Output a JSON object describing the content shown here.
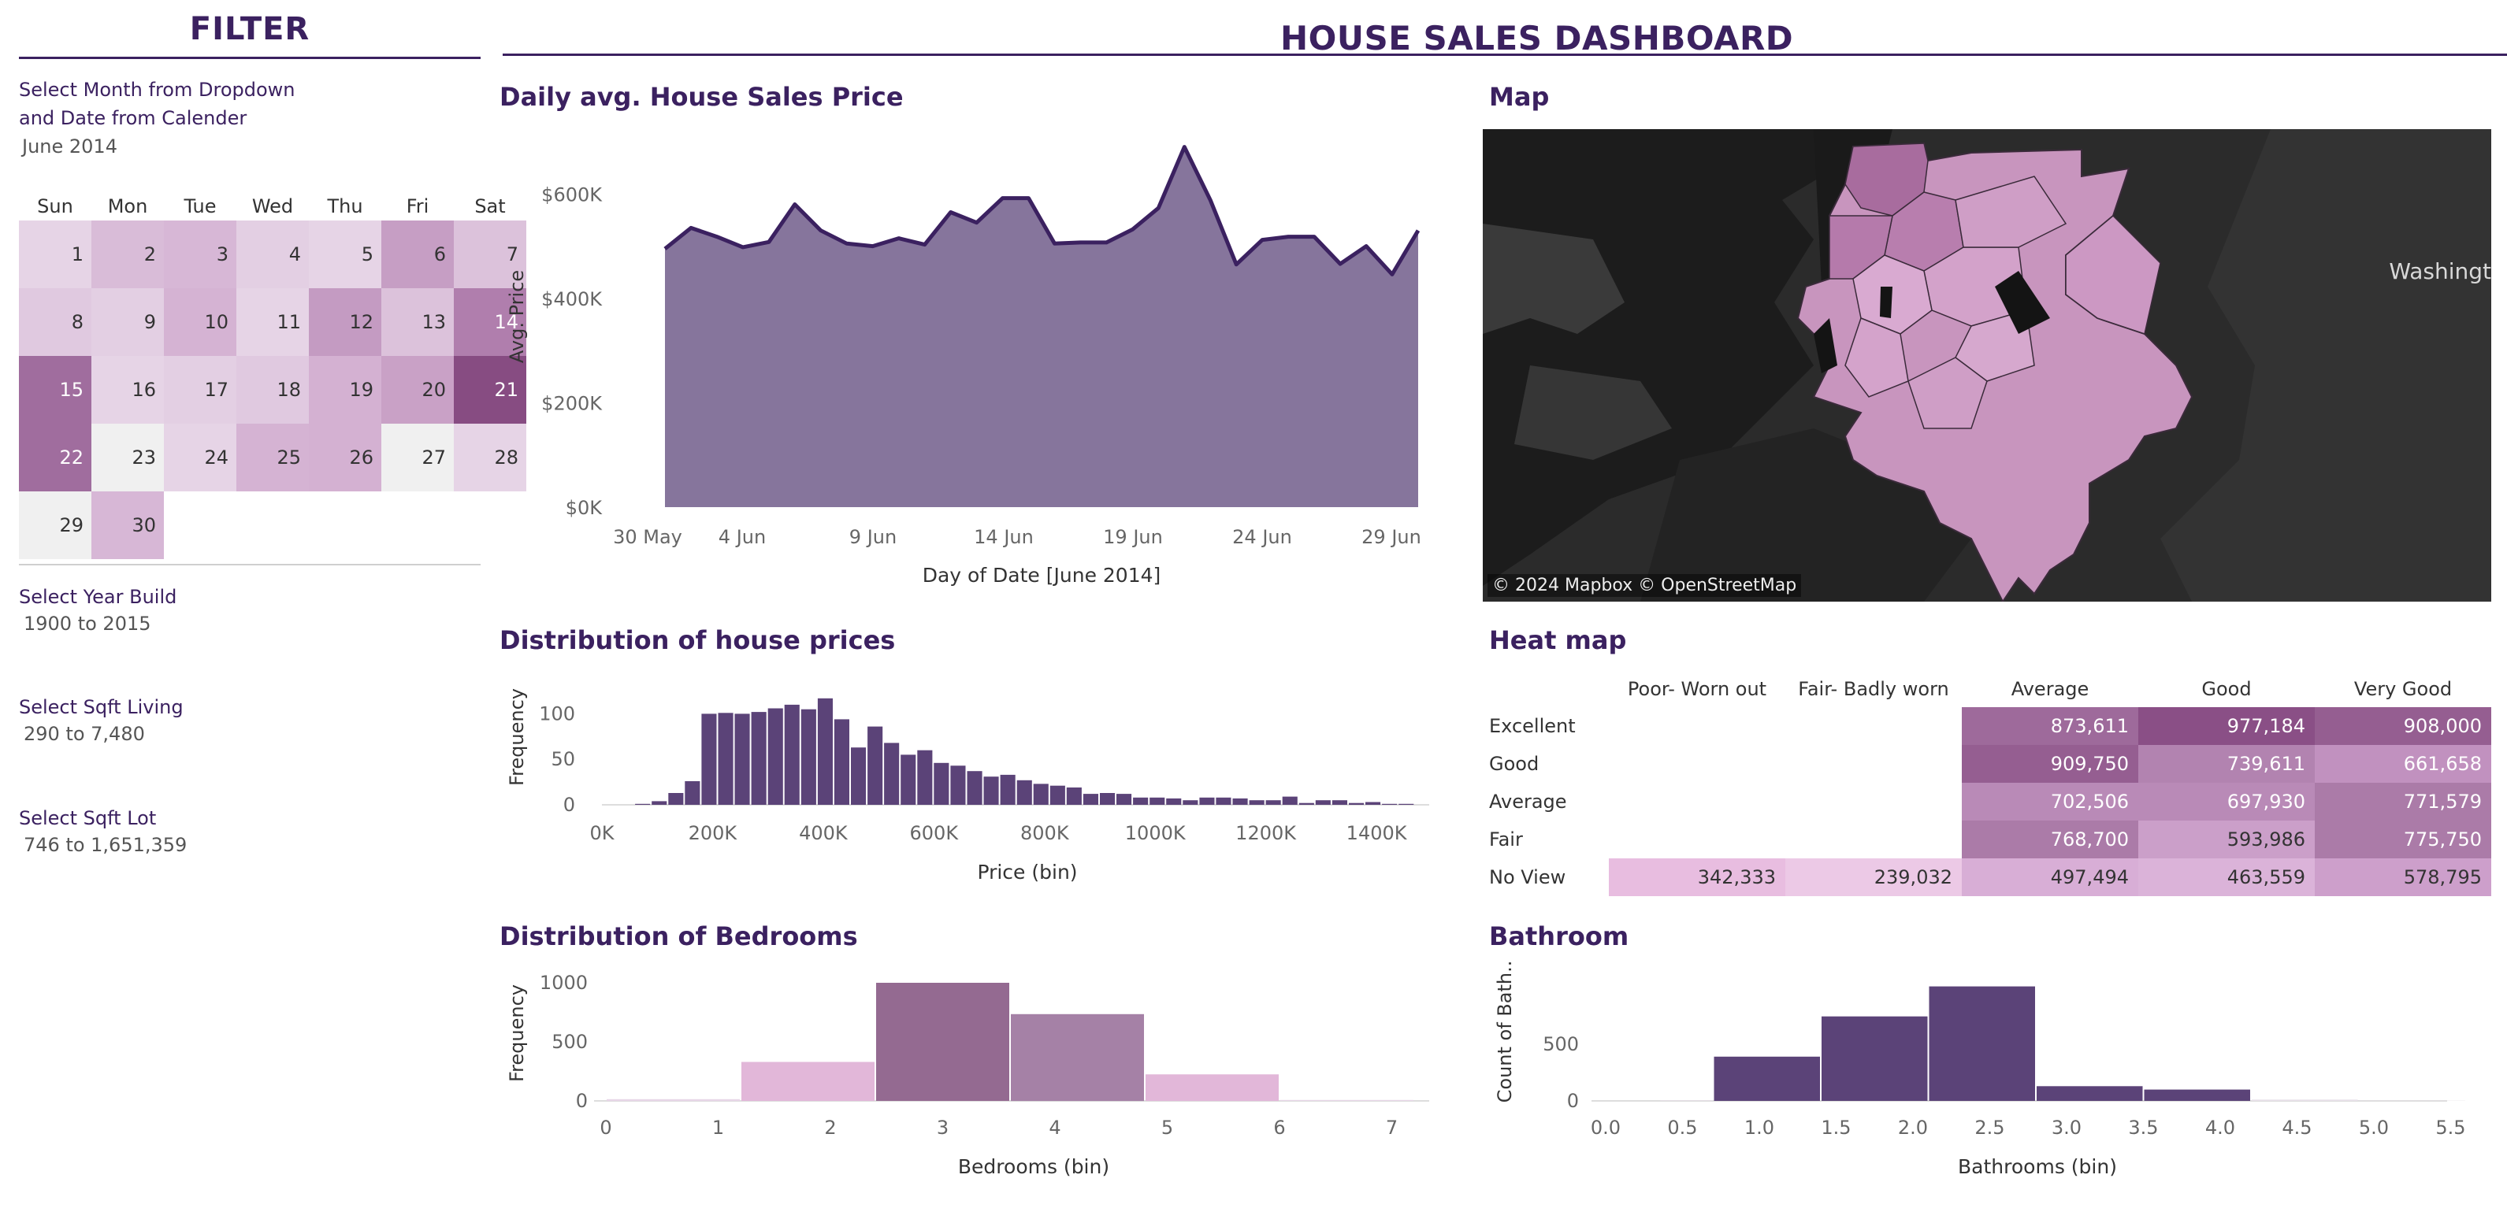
{
  "sidebar": {
    "title": "FILTER",
    "calendar_label": "Select Month from Dropdown\nand Date from Calender",
    "month_value": "June 2014",
    "weekdays": [
      "Sun",
      "Mon",
      "Tue",
      "Wed",
      "Thu",
      "Fri",
      "Sat"
    ],
    "days": [
      {
        "d": "1",
        "c": "#e6d4e6"
      },
      {
        "d": "2",
        "c": "#d9bcd8"
      },
      {
        "d": "3",
        "c": "#d7b7d6"
      },
      {
        "d": "4",
        "c": "#e3cfe3"
      },
      {
        "d": "5",
        "c": "#e6d4e6"
      },
      {
        "d": "6",
        "c": "#c69ec4"
      },
      {
        "d": "7",
        "c": "#dcc2db"
      },
      {
        "d": "8",
        "c": "#e0c9e0"
      },
      {
        "d": "9",
        "c": "#e3cfe3"
      },
      {
        "d": "10",
        "c": "#d5b3d3"
      },
      {
        "d": "11",
        "c": "#e6d4e6"
      },
      {
        "d": "12",
        "c": "#c49bc2"
      },
      {
        "d": "13",
        "c": "#dcc2db"
      },
      {
        "d": "14",
        "c": "#b07ead"
      },
      {
        "d": "15",
        "c": "#a06d9e"
      },
      {
        "d": "16",
        "c": "#e6d4e6"
      },
      {
        "d": "17",
        "c": "#e3cfe3"
      },
      {
        "d": "18",
        "c": "#e0c9e0"
      },
      {
        "d": "19",
        "c": "#d4b1d2"
      },
      {
        "d": "20",
        "c": "#c9a1c6"
      },
      {
        "d": "21",
        "c": "#874c82"
      },
      {
        "d": "22",
        "c": "#a06d9e"
      },
      {
        "d": "23",
        "c": "#f0f0f0"
      },
      {
        "d": "24",
        "c": "#e6d4e6"
      },
      {
        "d": "25",
        "c": "#d5b3d3"
      },
      {
        "d": "26",
        "c": "#d4b1d2"
      },
      {
        "d": "27",
        "c": "#f0f0f0"
      },
      {
        "d": "28",
        "c": "#e6d4e6"
      },
      {
        "d": "29",
        "c": "#f0f0f0"
      },
      {
        "d": "30",
        "c": "#d7b7d6"
      }
    ],
    "filters": [
      {
        "label": "Select Year Build",
        "value": "1900 to 2015"
      },
      {
        "label": "Select Sqft Living",
        "value": "290 to 7,480"
      },
      {
        "label": "Select Sqft Lot",
        "value": "746 to 1,651,359"
      }
    ]
  },
  "header": {
    "title": "HOUSE SALES DASHBOARD"
  },
  "colors": {
    "accent": "#3b2160",
    "area": "#86759c",
    "bar": "#5b4378"
  },
  "map": {
    "title": "Map",
    "place_label": "Washingt",
    "attribution": "© 2024 Mapbox © OpenStreetMap"
  },
  "chart_data": [
    {
      "id": "daily",
      "type": "area",
      "title": "Daily avg. House Sales Price",
      "xlabel": "Day of Date [June 2014]",
      "ylabel": "Avg. Price",
      "x_ticks": [
        "30 May",
        "4 Jun",
        "9 Jun",
        "14 Jun",
        "19 Jun",
        "24 Jun",
        "29 Jun"
      ],
      "y_ticks": [
        "$0K",
        "$200K",
        "$400K",
        "$600K"
      ],
      "ylim": [
        0,
        700000
      ],
      "x": [
        "2 Jun",
        "3 Jun",
        "4 Jun",
        "5 Jun",
        "6 Jun",
        "7 Jun",
        "8 Jun",
        "9 Jun",
        "10 Jun",
        "11 Jun",
        "12 Jun",
        "13 Jun",
        "14 Jun",
        "15 Jun",
        "16 Jun",
        "17 Jun",
        "18 Jun",
        "19 Jun",
        "20 Jun",
        "21 Jun",
        "22 Jun",
        "23 Jun",
        "24 Jun",
        "25 Jun",
        "26 Jun",
        "27 Jun",
        "28 Jun",
        "29 Jun",
        "30 Jun"
      ],
      "values": [
        495000,
        535000,
        518000,
        498000,
        508000,
        580000,
        530000,
        505000,
        500000,
        515000,
        503000,
        565000,
        545000,
        592000,
        592000,
        505000,
        507000,
        507000,
        532000,
        573000,
        690000,
        588000,
        465000,
        512000,
        518000,
        518000,
        466000,
        500000,
        446000,
        530000
      ]
    },
    {
      "id": "prices",
      "type": "bar",
      "title": "Distribution of house prices",
      "xlabel": "Price (bin)",
      "ylabel": "Frequency",
      "x_ticks": [
        "0K",
        "200K",
        "400K",
        "600K",
        "800K",
        "1000K",
        "1200K",
        "1400K"
      ],
      "y_ticks": [
        "0",
        "50",
        "100"
      ],
      "ylim": [
        0,
        135
      ],
      "bin_start_k": 60,
      "bin_width_k": 30,
      "values": [
        1,
        4,
        13,
        26,
        100,
        101,
        100,
        102,
        106,
        110,
        105,
        117,
        94,
        63,
        86,
        68,
        55,
        60,
        46,
        43,
        37,
        31,
        33,
        27,
        23,
        21,
        19,
        12,
        13,
        12,
        8,
        8,
        7,
        5,
        8,
        8,
        7,
        5,
        5,
        9,
        2,
        5,
        5,
        2,
        3,
        1,
        1
      ]
    },
    {
      "id": "bedrooms",
      "type": "bar",
      "title": "Distribution of Bedrooms",
      "xlabel": "Bedrooms (bin)",
      "ylabel": "Frequency",
      "x_ticks": [
        "0",
        "1",
        "2",
        "3",
        "4",
        "5",
        "6",
        "7"
      ],
      "y_ticks": [
        "0",
        "500",
        "1000"
      ],
      "ylim": [
        0,
        1100
      ],
      "bins": [
        {
          "x0": 0,
          "x1": 1.2,
          "v": 15,
          "c": "#e8d6e8"
        },
        {
          "x0": 1.2,
          "x1": 2.4,
          "v": 330,
          "c": "#e2b7d9"
        },
        {
          "x0": 2.4,
          "x1": 3.6,
          "v": 1000,
          "c": "#946a91"
        },
        {
          "x0": 3.6,
          "x1": 4.8,
          "v": 735,
          "c": "#a581a6"
        },
        {
          "x0": 4.8,
          "x1": 6.0,
          "v": 225,
          "c": "#e2b7d9"
        },
        {
          "x0": 6.0,
          "x1": 7.2,
          "v": 8,
          "c": "#e8d6e8"
        }
      ]
    },
    {
      "id": "bathrooms",
      "type": "bar",
      "title": "Bathroom",
      "xlabel": "Bathrooms (bin)",
      "ylabel": "Count of Bath..",
      "x_ticks": [
        "0.0",
        "0.5",
        "1.0",
        "1.5",
        "2.0",
        "2.5",
        "3.0",
        "3.5",
        "4.0",
        "4.5",
        "5.0",
        "5.5"
      ],
      "y_ticks": [
        "0",
        "500"
      ],
      "ylim": [
        0,
        1000
      ],
      "bins": [
        {
          "x0": 0.35,
          "x1": 0.7,
          "v": 4
        },
        {
          "x0": 0.7,
          "x1": 1.4,
          "v": 390
        },
        {
          "x0": 1.4,
          "x1": 2.1,
          "v": 745
        },
        {
          "x0": 2.1,
          "x1": 2.8,
          "v": 1010
        },
        {
          "x0": 2.8,
          "x1": 3.5,
          "v": 130
        },
        {
          "x0": 3.5,
          "x1": 4.2,
          "v": 100
        },
        {
          "x0": 4.2,
          "x1": 4.9,
          "v": 12
        },
        {
          "x0": 4.9,
          "x1": 5.6,
          "v": 2
        }
      ]
    }
  ],
  "heatmap": {
    "title": "Heat map",
    "columns": [
      "Poor- Worn out",
      "Fair- Badly worn",
      "Average",
      "Good",
      "Very Good"
    ],
    "rows": [
      {
        "label": "Excellent",
        "cells": [
          {
            "v": "",
            "c": ""
          },
          {
            "v": "",
            "c": ""
          },
          {
            "v": "873,611",
            "c": "#9e6a9b"
          },
          {
            "v": "977,184",
            "c": "#8a4f86"
          },
          {
            "v": "908,000",
            "c": "#955e91"
          }
        ]
      },
      {
        "label": "Good",
        "cells": [
          {
            "v": "",
            "c": ""
          },
          {
            "v": "",
            "c": ""
          },
          {
            "v": "909,750",
            "c": "#955e91"
          },
          {
            "v": "739,611",
            "c": "#b283b0"
          },
          {
            "v": "661,658",
            "c": "#c191bf"
          }
        ]
      },
      {
        "label": "Average",
        "cells": [
          {
            "v": "",
            "c": ""
          },
          {
            "v": "",
            "c": ""
          },
          {
            "v": "702,506",
            "c": "#b98ab7"
          },
          {
            "v": "697,930",
            "c": "#b98ab7"
          },
          {
            "v": "771,579",
            "c": "#ab7ba8"
          }
        ]
      },
      {
        "label": "Fair",
        "cells": [
          {
            "v": "",
            "c": ""
          },
          {
            "v": "",
            "c": ""
          },
          {
            "v": "768,700",
            "c": "#ab7ba8"
          },
          {
            "v": "593,986",
            "c": "#cb9fc9"
          },
          {
            "v": "775,750",
            "c": "#ab7ba8"
          }
        ]
      },
      {
        "label": "No View",
        "cells": [
          {
            "v": "342,333",
            "c": "#e8bde0"
          },
          {
            "v": "239,032",
            "c": "#ecc9e6"
          },
          {
            "v": "497,494",
            "c": "#d8aed6"
          },
          {
            "v": "463,559",
            "c": "#dbb3d9"
          },
          {
            "v": "578,795",
            "c": "#cd9fcb"
          }
        ]
      }
    ]
  }
}
